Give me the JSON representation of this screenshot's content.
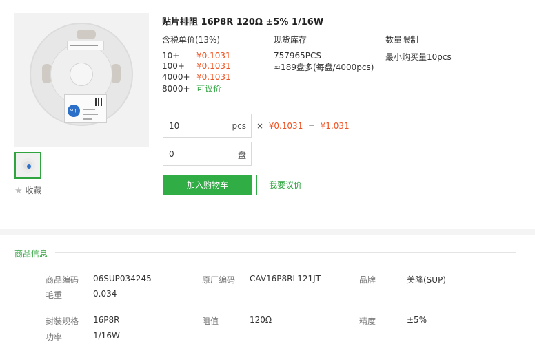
{
  "product": {
    "title": "贴片排阻 16P8R 120Ω ±5% 1/16W",
    "image_label": "sup"
  },
  "favorite": {
    "label": "收藏"
  },
  "pricing": {
    "price_header": "含税单价(13%)",
    "stock_header": "现货库存",
    "limit_header": "数量限制",
    "tiers": [
      {
        "qty": "10+",
        "price": "¥0.1031"
      },
      {
        "qty": "100+",
        "price": "¥0.1031"
      },
      {
        "qty": "4000+",
        "price": "¥0.1031"
      },
      {
        "qty": "8000+",
        "price": "可议价"
      }
    ],
    "stock_count": "757965PCS",
    "stock_reels": "≈189盘多(每盘/4000pcs)",
    "limit_text": "最小购买量10pcs"
  },
  "order": {
    "pcs_value": "10",
    "pcs_unit": "pcs",
    "reel_value": "0",
    "reel_unit": "盘",
    "times": "×",
    "unit_price": "¥0.1031",
    "equals": "=",
    "total": "¥1.031",
    "add_to_cart": "加入购物车",
    "request_quote": "我要议价"
  },
  "info": {
    "section_title": "商品信息",
    "specs": [
      {
        "key": "商品编码",
        "value": "06SUP034245"
      },
      {
        "key": "原厂编码",
        "value": "CAV16P8RL121JT"
      },
      {
        "key": "品牌",
        "value": "美隆(SUP)"
      },
      {
        "key": "毛重",
        "value": "0.034"
      },
      {
        "key": "封装规格",
        "value": "16P8R"
      },
      {
        "key": "阻值",
        "value": "120Ω"
      },
      {
        "key": "精度",
        "value": "±5%"
      },
      {
        "key": "功率",
        "value": "1/16W"
      }
    ]
  },
  "colors": {
    "accent_green": "#31ad46",
    "price_orange": "#f2501f"
  }
}
